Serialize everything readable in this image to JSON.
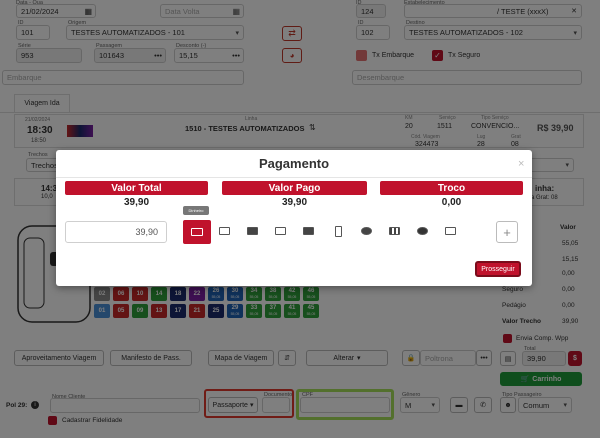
{
  "top": {
    "data_label": "Data - Qua",
    "data_value": "21/02/2024",
    "data_volta_placeholder": "Data Volta",
    "id_label": "ID",
    "id_value": "124",
    "estab_label": "Estabelecimento",
    "estab_value": "/ TESTE (xxxX)",
    "id1_label": "ID",
    "id1_value": "101",
    "origem_label": "Origem",
    "origem_value": "TESTES AUTOMATIZADOS - 101",
    "id2_label": "ID",
    "id2_value": "102",
    "destino_label": "Destino",
    "destino_value": "TESTES AUTOMATIZADOS - 102",
    "serie_label": "Série",
    "serie_value": "953",
    "passagem_label": "Passagem",
    "passagem_value": "101643",
    "desconto_label": "Desconto (-)",
    "desconto_value": "15,15",
    "tx_embarque": "Tx Embarque",
    "tx_seguro": "Tx Seguro",
    "embarque_placeholder": "Embarque",
    "desembarque_placeholder": "Desembarque"
  },
  "tab": {
    "label": "Viagem Ida"
  },
  "trip": {
    "date": "21/02/2024",
    "time": "18:30",
    "sub_time": "18:50",
    "linha_label": "Linha",
    "linha_value": "1510 - TESTES AUTOMATIZADOS",
    "kml_label": "KM",
    "kml_value": "20",
    "servico_label": "Serviço",
    "servico_value": "1511",
    "tipo_label": "Tipo Serviço",
    "tipo_value": "CONVENCIO...",
    "price": "R$ 39,90",
    "cod_label": "Cód. Viagem",
    "cod_value": "324473",
    "lug_label": "Lug",
    "lug_value": "28",
    "grat_label": "Grat",
    "grat_value": "08",
    "trechos_label": "Trechos",
    "trechos_value": "Trechos",
    "left_time": "14:3",
    "left_sub": "10,0",
    "right_title": "inha:",
    "right_sub": "a Grat: 08"
  },
  "modal": {
    "title": "Pagamento",
    "close": "×",
    "valor_total_label": "Valor Total",
    "valor_total": "39,90",
    "valor_pago_label": "Valor Pago",
    "valor_pago": "39,90",
    "troco_label": "Troco",
    "troco": "0,00",
    "input_value": "39,90",
    "tooltip": "Dinheiro",
    "add": "+",
    "prosseguir": "Prosseguir"
  },
  "seats": {
    "row1": [
      "02",
      "06",
      "10",
      "14",
      "18",
      "22",
      "26",
      "30",
      "34",
      "38",
      "42",
      "46"
    ],
    "row1_price": "55,05",
    "row2": [
      "01",
      "05",
      "09",
      "13",
      "17",
      "21",
      "25",
      "29",
      "33",
      "37",
      "41",
      "45"
    ],
    "row2_price": "55,05"
  },
  "summary": {
    "valor_label": "Valor",
    "rows": [
      {
        "label": "",
        "value": "55,05"
      },
      {
        "label": "",
        "value": "15,15"
      },
      {
        "label": "",
        "value": "0,00"
      },
      {
        "label": "Seguro",
        "value": "0,00"
      },
      {
        "label": "Pedágio",
        "value": "0,00"
      },
      {
        "label": "Valor Trecho",
        "value": "39,90"
      }
    ],
    "envia_comp": "Envia Comp. Wpp",
    "total_label": "Total",
    "total_value": "39,90",
    "dollar": "$",
    "carrinho": "Carrinho"
  },
  "toolbar": {
    "aproveitamento": "Aproveitamento Viagem",
    "manifesto": "Manifesto de Pass.",
    "mapa": "Mapa de Viagem",
    "alterar": "Alterar",
    "poltrona_placeholder": "Poltrona"
  },
  "passenger": {
    "pol_label": "Pol 29:",
    "nome_label": "Nome Cliente",
    "doc_type": "Passaporte",
    "doc_label": "Documento",
    "cpf_label": "CPF",
    "cpf_value": "",
    "genero_label": "Gênero",
    "genero_value": "M",
    "tipo_label": "Tipo Passageiro",
    "tipo_value": "Comum",
    "cadastrar": "Cadastrar Fidelidade"
  },
  "colors": {
    "accent_red": "#c0122c",
    "seat_red": "#c62828",
    "seat_green": "#2e9e3a",
    "seat_blue": "#1e63b5",
    "seat_darkblue": "#1a2a6c",
    "seat_purple": "#7b1fa2",
    "seat_lightblue": "#4a90d9",
    "seat_grey": "#8a8a8a",
    "carrinho_green": "#1f9d3a"
  }
}
